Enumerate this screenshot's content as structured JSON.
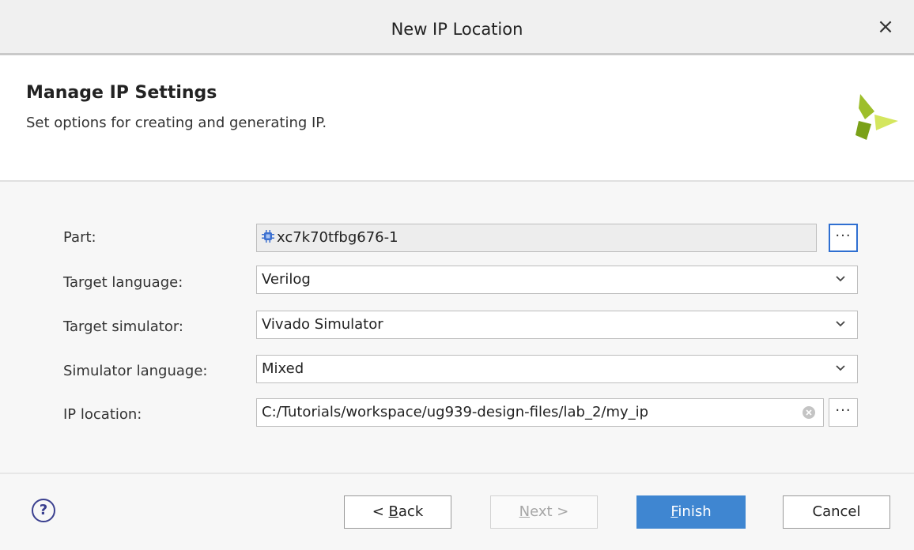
{
  "window": {
    "title": "New IP Location"
  },
  "header": {
    "title": "Manage IP Settings",
    "subtitle": "Set options for creating and generating IP."
  },
  "form": {
    "part": {
      "label": "Part:",
      "value": "xc7k70tfbg676-1",
      "browse": "···"
    },
    "target_language": {
      "label": "Target language:",
      "value": "Verilog"
    },
    "target_simulator": {
      "label": "Target simulator:",
      "value": "Vivado Simulator"
    },
    "simulator_language": {
      "label": "Simulator language:",
      "value": "Mixed"
    },
    "ip_location": {
      "label": "IP location:",
      "value": "C:/Tutorials/workspace/ug939-design-files/lab_2/my_ip",
      "browse": "···"
    }
  },
  "footer": {
    "help": "?",
    "back_mnemonic": "B",
    "back_rest": "ack",
    "back_prefix": "< ",
    "next_mnemonic": "N",
    "next_rest": "ext >",
    "finish_mnemonic": "F",
    "finish_rest": "inish",
    "cancel": "Cancel"
  },
  "colors": {
    "accent": "#3f86d1",
    "logo_dark": "#8fb21e",
    "logo_light": "#c9df4a"
  }
}
